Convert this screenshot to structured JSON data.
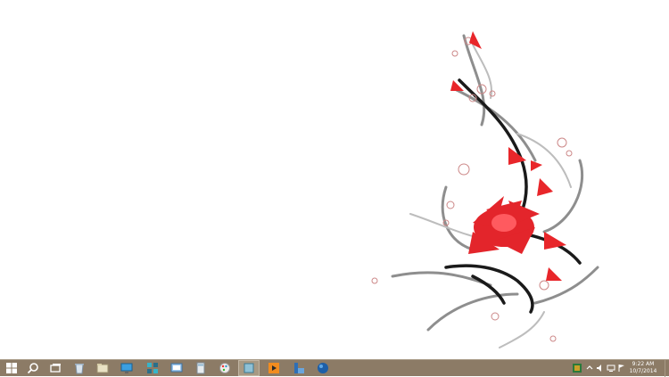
{
  "wallpaper": {
    "name": "red-flower-vine-wallpaper",
    "accent": "#e8262a",
    "vine": "#1a1a1a"
  },
  "taskbar": {
    "background": "#8c7b66",
    "buttons": [
      {
        "icon": "windows-start-icon"
      },
      {
        "icon": "search-icon"
      },
      {
        "icon": "task-view-icon"
      },
      {
        "icon": "recycle-bin-icon"
      },
      {
        "icon": "file-explorer-icon"
      },
      {
        "icon": "computer-monitor-icon"
      },
      {
        "icon": "network-icon"
      },
      {
        "icon": "control-panel-icon"
      },
      {
        "icon": "calculator-icon"
      },
      {
        "icon": "paint-icon"
      },
      {
        "icon": "app-icon"
      },
      {
        "icon": "media-player-icon"
      },
      {
        "icon": "window-icon"
      },
      {
        "icon": "globe-icon"
      }
    ]
  },
  "tray": {
    "icons": [
      "app-tray-icon",
      "arrow-up-icon",
      "speaker-icon",
      "network-tray-icon",
      "flag-icon"
    ],
    "time": "9:22 AM",
    "date": "10/7/2014"
  }
}
